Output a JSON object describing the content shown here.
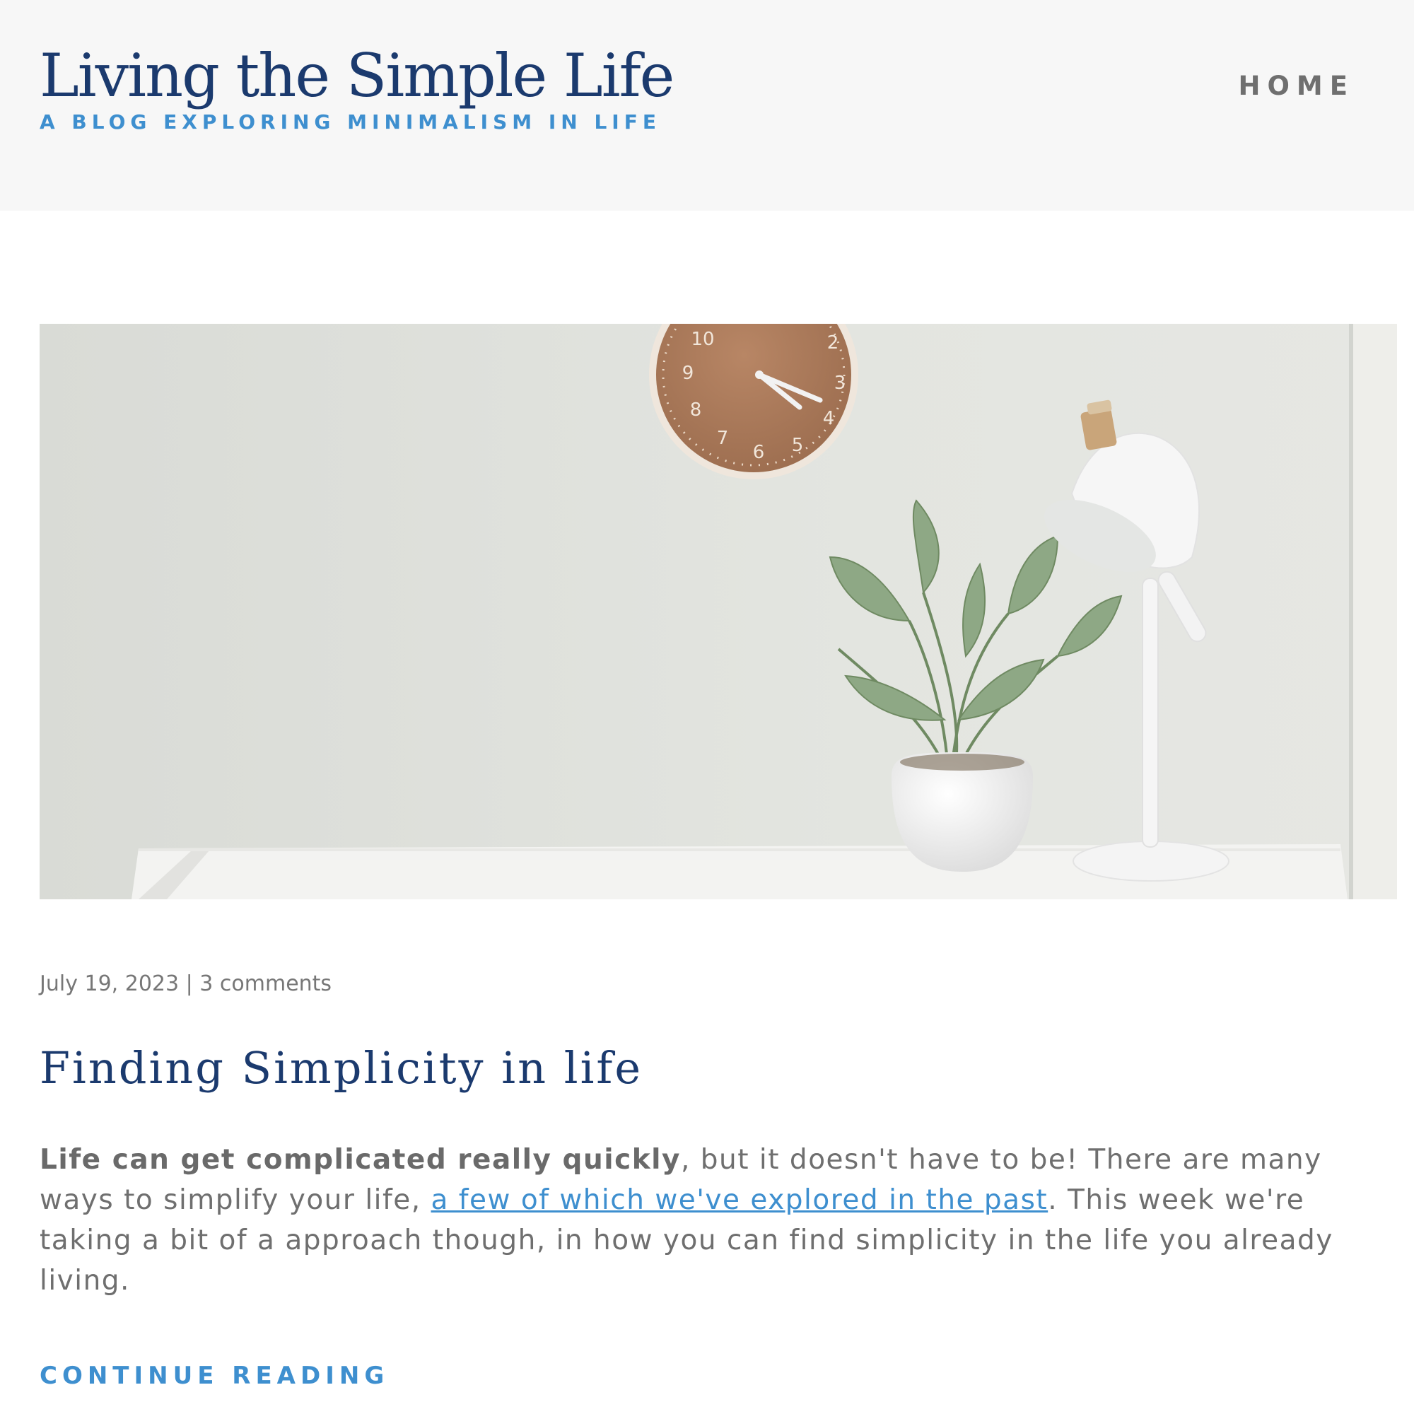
{
  "header": {
    "site_title": "Living the Simple Life",
    "tagline": "A BLOG EXPLORING MINIMALISM IN LIFE",
    "nav": {
      "home_label": "HOME"
    }
  },
  "hero": {
    "clock_numbers": [
      "10",
      "2",
      "9",
      "3",
      "8",
      "4",
      "7",
      "6",
      "5"
    ]
  },
  "post": {
    "date": "July 19, 2023",
    "separator": " | ",
    "comments": "3 comments",
    "title": "Finding Simplicity in life",
    "excerpt": {
      "bold_lead": "Life can get complicated really quickly",
      "text_1": ", but it doesn't have to be! There are many ways to simplify your life, ",
      "link_text": "a few of which we've explored in the past",
      "text_2": ". This week we're taking a bit of a approach though, in how you can find simplicity in the life you already living."
    },
    "continue_label": "CONTINUE READING"
  },
  "colors": {
    "title": "#1b3a6e",
    "accent": "#3e8fcf",
    "text": "#6f6f6f",
    "header_bg": "#f7f7f7"
  }
}
